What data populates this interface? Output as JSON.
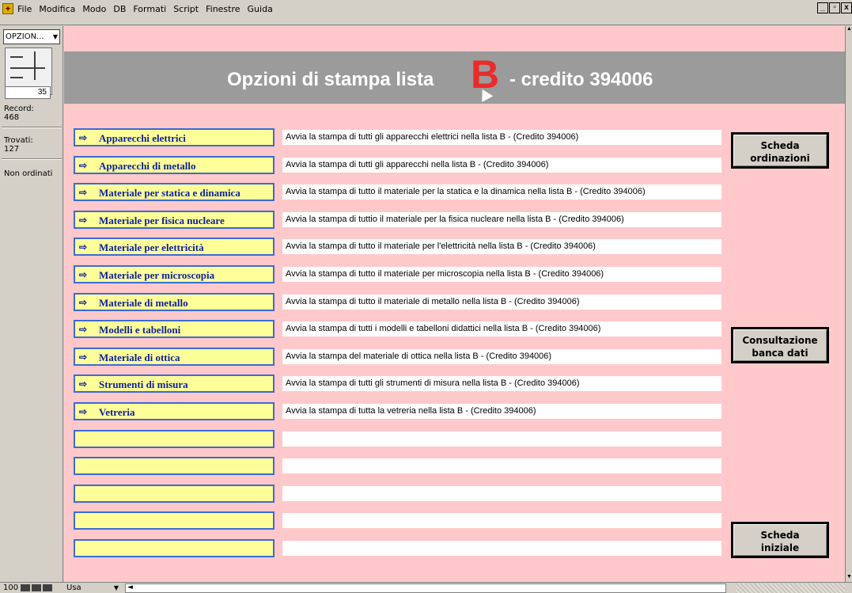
{
  "menubar": {
    "items": [
      "File",
      "Modifica",
      "Modo",
      "DB",
      "Formati",
      "Script",
      "Finestre",
      "Guida"
    ],
    "window_controls": [
      "_",
      "▫",
      "x"
    ]
  },
  "left": {
    "layout_select": "OPZION...",
    "booklet_number": "35",
    "record_label": "Record:",
    "record_value": "468",
    "found_label": "Trovati:",
    "found_value": "127",
    "sort_status": "Non ordinati"
  },
  "header": {
    "title": "Opzioni di stampa lista",
    "letter": "B",
    "credit": "-  credito 394006"
  },
  "rows": [
    {
      "label": "Apparecchi elettrici",
      "desc": "Avvia la stampa di tutti gli apparecchi elettrici nella lista B - (Credito 394006)"
    },
    {
      "label": "Apparecchi di metallo",
      "desc": "Avvia la stampa di tutti gli apparecchi  nella lista B - (Credito 394006)"
    },
    {
      "label": "Materiale per statica e dinamica",
      "desc": "Avvia la stampa di tutto il materiale per la statica e la dinamica nella lista B - (Credito 394006)"
    },
    {
      "label": "Materiale per fisica nucleare",
      "desc": "Avvia la stampa di tuttio il materiale per la fisica nucleare nella lista B - (Credito 394006)"
    },
    {
      "label": "Materiale per elettricità",
      "desc": "Avvia la stampa di tutto il materiale per l'elettricità nella lista B - (Credito 394006)"
    },
    {
      "label": "Materiale per microscopia",
      "desc": "Avvia la stampa di tutto il materiale per microscopia nella lista B - (Credito 394006)"
    },
    {
      "label": "Materiale di metallo",
      "desc": "Avvia la stampa di tutto il materiale di metallo nella lista B - (Credito 394006)"
    },
    {
      "label": "Modelli e tabelloni",
      "desc": "Avvia la stampa di tutti i modelli e tabelloni didattici nella lista B - (Credito 394006)"
    },
    {
      "label": "Materiale di ottica",
      "desc": "Avvia la stampa del materiale di ottica nella lista B - (Credito 394006)"
    },
    {
      "label": "Strumenti di misura",
      "desc": "Avvia la stampa di tutti gli strumenti di misura nella lista B - (Credito 394006)"
    },
    {
      "label": "Vetreria",
      "desc": "Avvia la stampa di tutta la vetreria nella lista B - (Credito 394006)"
    }
  ],
  "side_buttons": {
    "ordinazioni": [
      "Scheda",
      "ordinazioni"
    ],
    "consultazione": [
      "Consultazione",
      "banca dati"
    ],
    "iniziale": [
      "Scheda",
      "iniziale"
    ]
  },
  "bottombar": {
    "zoom": "100",
    "mode": "Usa"
  },
  "icons": {
    "row_arrow": "right-arrow-icon"
  },
  "colors": {
    "background": "#ffc9cb",
    "header_band": "#9b9b9b",
    "header_letter": "#ec2a2a",
    "button_fill": "#ffff99",
    "button_text": "#0b1f9e",
    "button_border": "#3a6bd6"
  }
}
